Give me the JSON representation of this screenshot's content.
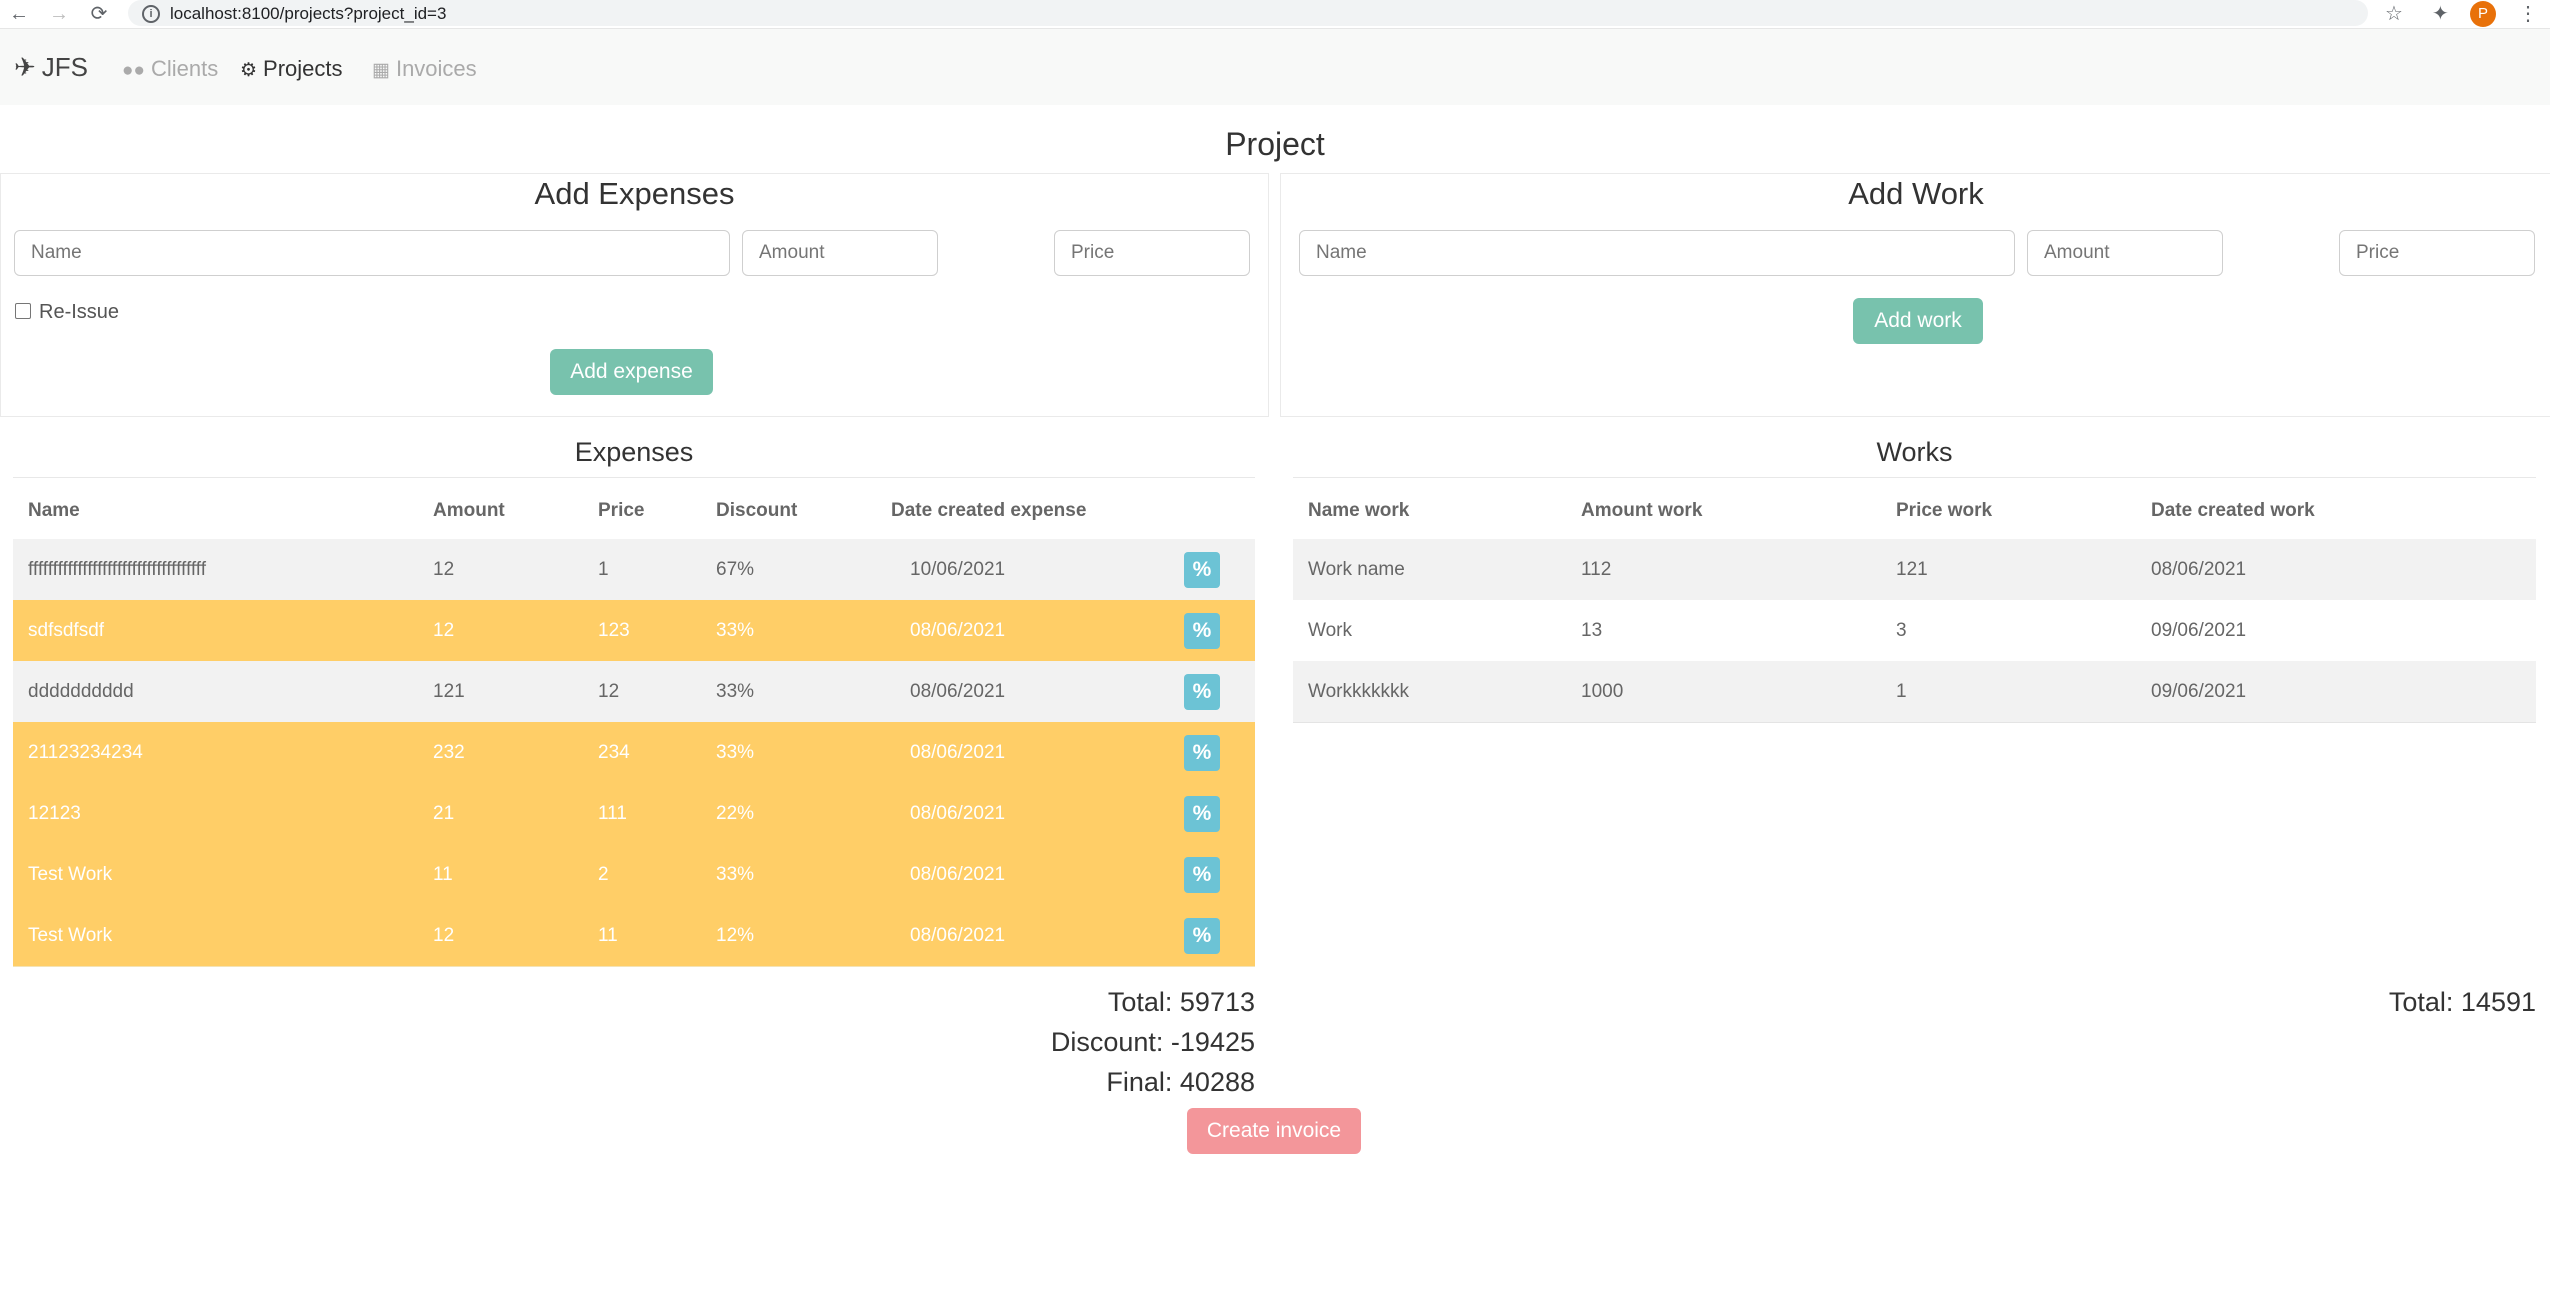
{
  "browser": {
    "back_icon": "arrow-left-icon",
    "forward_icon": "arrow-right-icon",
    "reload_icon": "reload-icon",
    "url": "localhost:8100/projects?project_id=3",
    "avatar_initial": "P"
  },
  "navbar": {
    "brand": "JFS",
    "links": [
      {
        "label": "Clients",
        "icon": "users-icon",
        "state": "muted"
      },
      {
        "label": "Projects",
        "icon": "cogs-icon",
        "state": "active"
      },
      {
        "label": "Invoices",
        "icon": "table-icon",
        "state": "muted"
      }
    ]
  },
  "page": {
    "title": "Project"
  },
  "add_expenses": {
    "title": "Add Expenses",
    "name_placeholder": "Name",
    "amount_placeholder": "Amount",
    "price_placeholder": "Price",
    "reissue_label": "Re-Issue",
    "submit_label": "Add expense"
  },
  "add_work": {
    "title": "Add Work",
    "name_placeholder": "Name",
    "amount_placeholder": "Amount",
    "price_placeholder": "Price",
    "submit_label": "Add work"
  },
  "expenses": {
    "title": "Expenses",
    "columns": [
      "Name",
      "Amount",
      "Price",
      "Discount",
      "Date created expense"
    ],
    "discount_button_label": "%",
    "rows": [
      {
        "name": "ffffffffffffffffffffffffffffffffffff",
        "amount": "12",
        "price": "1",
        "discount": "67%",
        "date": "10/06/2021",
        "style": "light"
      },
      {
        "name": "sdfsdfsdf",
        "amount": "12",
        "price": "123",
        "discount": "33%",
        "date": "08/06/2021",
        "style": "warn"
      },
      {
        "name": "dddddddddd",
        "amount": "121",
        "price": "12",
        "discount": "33%",
        "date": "08/06/2021",
        "style": "light"
      },
      {
        "name": "21123234234",
        "amount": "232",
        "price": "234",
        "discount": "33%",
        "date": "08/06/2021",
        "style": "warn"
      },
      {
        "name": "12123",
        "amount": "21",
        "price": "111",
        "discount": "22%",
        "date": "08/06/2021",
        "style": "warn"
      },
      {
        "name": "Test Work",
        "amount": "11",
        "price": "2",
        "discount": "33%",
        "date": "08/06/2021",
        "style": "warn"
      },
      {
        "name": "Test Work",
        "amount": "12",
        "price": "11",
        "discount": "12%",
        "date": "08/06/2021",
        "style": "warn"
      }
    ],
    "total": "Total: 59713",
    "discount": "Discount: -19425",
    "final": "Final: 40288"
  },
  "works": {
    "title": "Works",
    "columns": [
      "Name work",
      "Amount work",
      "Price work",
      "Date created work"
    ],
    "rows": [
      {
        "name": "Work name",
        "amount": "112",
        "price": "121",
        "date": "08/06/2021",
        "style": "light"
      },
      {
        "name": "Work",
        "amount": "13",
        "price": "3",
        "date": "09/06/2021",
        "style": "plain"
      },
      {
        "name": "Workkkkkkk",
        "amount": "1000",
        "price": "1",
        "date": "09/06/2021",
        "style": "light"
      }
    ],
    "total": "Total: 14591"
  },
  "create_invoice_label": "Create invoice",
  "colors": {
    "success": "#78c2ad",
    "warning": "#ffce67",
    "info": "#6cc3d5",
    "danger": "#f3969a"
  }
}
